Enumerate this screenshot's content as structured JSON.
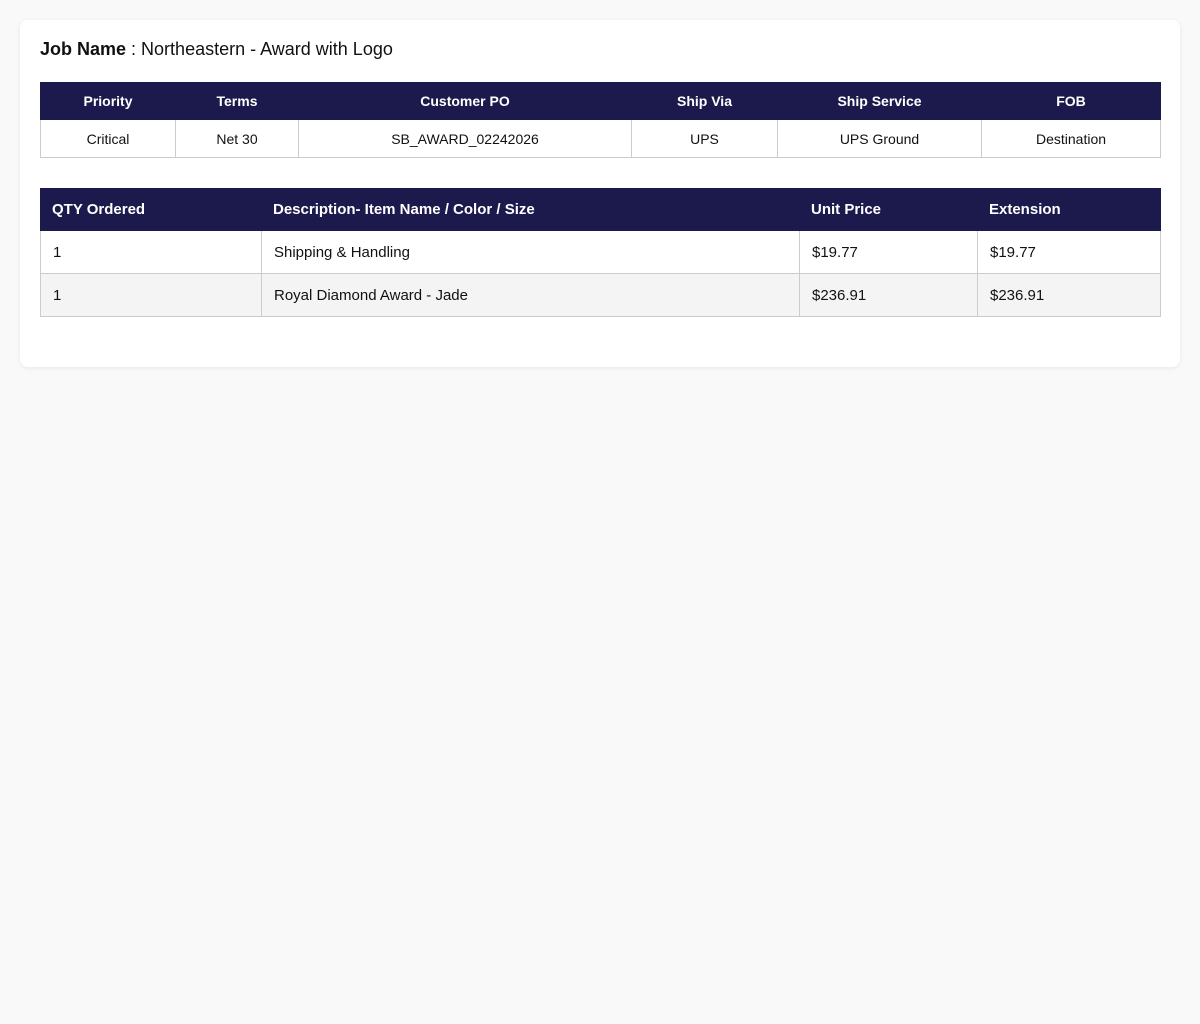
{
  "job": {
    "label": "Job Name",
    "separator": " : ",
    "value": "Northeastern - Award with Logo"
  },
  "order_info": {
    "headers": [
      "Priority",
      "Terms",
      "Customer PO",
      "Ship Via",
      "Ship Service",
      "FOB"
    ],
    "values": [
      "Critical",
      "Net 30",
      "SB_AWARD_02242026",
      "UPS",
      "UPS Ground",
      "Destination"
    ]
  },
  "line_items": {
    "headers": [
      "QTY Ordered",
      "Description- Item Name / Color / Size",
      "Unit Price",
      "Extension"
    ],
    "rows": [
      {
        "qty": "1",
        "description": "Shipping & Handling",
        "unit_price": "$19.77",
        "extension": "$19.77"
      },
      {
        "qty": "1",
        "description": "Royal Diamond Award - Jade",
        "unit_price": "$236.91",
        "extension": "$236.91"
      }
    ]
  },
  "colors": {
    "header_bg": "#1c1a4d",
    "header_text": "#ffffff",
    "alt_row_bg": "#f4f4f4",
    "page_bg": "#f9f9f9"
  }
}
